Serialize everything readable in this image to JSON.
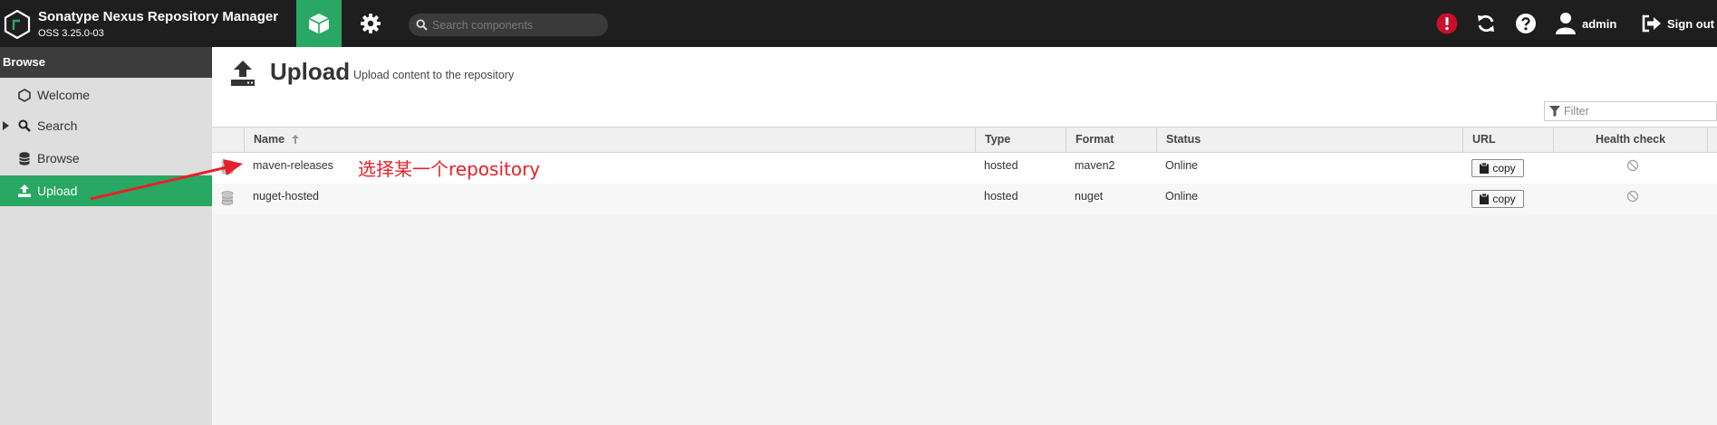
{
  "header": {
    "app_title": "Sonatype Nexus Repository Manager",
    "version": "OSS 3.25.0-03",
    "search_placeholder": "Search components",
    "user_label": "admin",
    "signout_label": "Sign out"
  },
  "sidebar": {
    "title": "Browse",
    "items": [
      {
        "label": "Welcome",
        "icon": "hexagon-icon"
      },
      {
        "label": "Search",
        "icon": "search-icon"
      },
      {
        "label": "Browse",
        "icon": "database-icon"
      },
      {
        "label": "Upload",
        "icon": "upload-icon",
        "active": true
      }
    ]
  },
  "page": {
    "title": "Upload",
    "subtitle": "Upload content to the repository",
    "filter_placeholder": "Filter"
  },
  "grid": {
    "columns": {
      "name": "Name",
      "type": "Type",
      "format": "Format",
      "status": "Status",
      "url": "URL",
      "health": "Health check"
    },
    "copy_label": "copy",
    "rows": [
      {
        "name": "maven-releases",
        "type": "hosted",
        "format": "maven2",
        "status": "Online"
      },
      {
        "name": "nuget-hosted",
        "type": "hosted",
        "format": "nuget",
        "status": "Online"
      }
    ]
  },
  "annotation": {
    "text": "选择某一个repository",
    "color": "#e8202a"
  },
  "colors": {
    "accent": "#28a862",
    "header_bg": "#1e1e1e",
    "alert": "#c8102e"
  }
}
